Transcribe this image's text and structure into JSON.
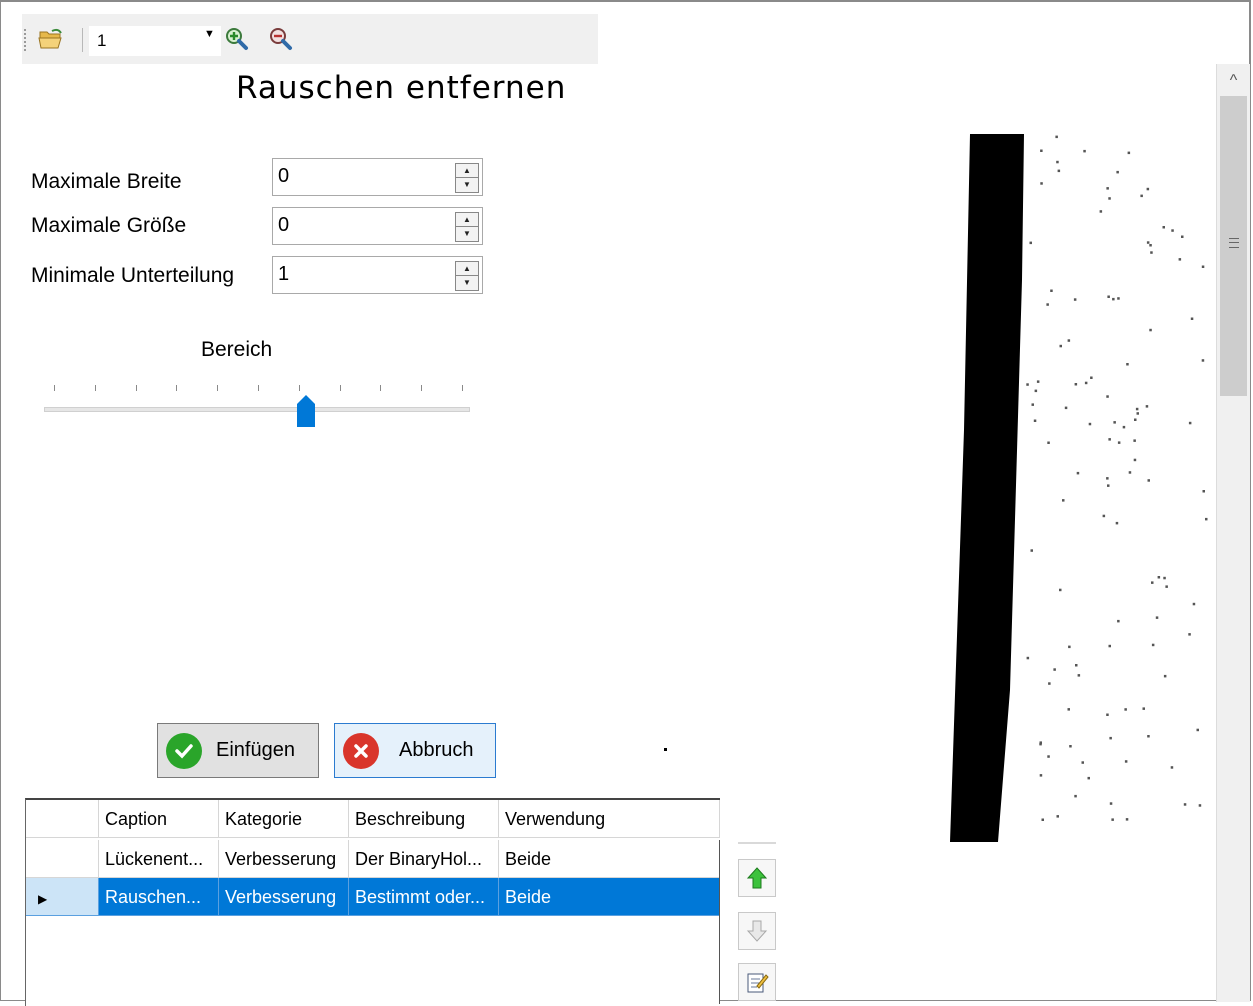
{
  "toolbar": {
    "page_value": "1",
    "open_icon": "folder-open-icon",
    "zoom_in_icon": "zoom-in-icon",
    "zoom_out_icon": "zoom-out-icon"
  },
  "panel": {
    "title": "Rauschen entfernen",
    "fields": [
      {
        "label": "Maximale Breite",
        "value": "0"
      },
      {
        "label": "Maximale Größe",
        "value": "0"
      },
      {
        "label": "Minimale Unterteilung",
        "value": "1"
      }
    ],
    "slider": {
      "label": "Bereich",
      "value_fraction": 0.6,
      "ticks": 11
    },
    "buttons": {
      "insert": "Einfügen",
      "cancel": "Abbruch"
    }
  },
  "grid": {
    "columns": [
      "Caption",
      "Kategorie",
      "Beschreibung",
      "Verwendung"
    ],
    "rows": [
      {
        "caption": "Lückenent...",
        "kategorie": "Verbesserung",
        "beschreibung": "Der BinaryHol...",
        "verwendung": "Beide",
        "selected": false
      },
      {
        "caption": "Rauschen...",
        "kategorie": "Verbesserung",
        "beschreibung": "Bestimmt oder...",
        "verwendung": "Beide",
        "selected": true
      }
    ]
  },
  "side_buttons": [
    "move-up-icon",
    "move-down-icon",
    "edit-icon"
  ],
  "colors": {
    "selection": "#0078d7",
    "accent_green": "#2aa52a",
    "accent_red": "#d9352b"
  }
}
